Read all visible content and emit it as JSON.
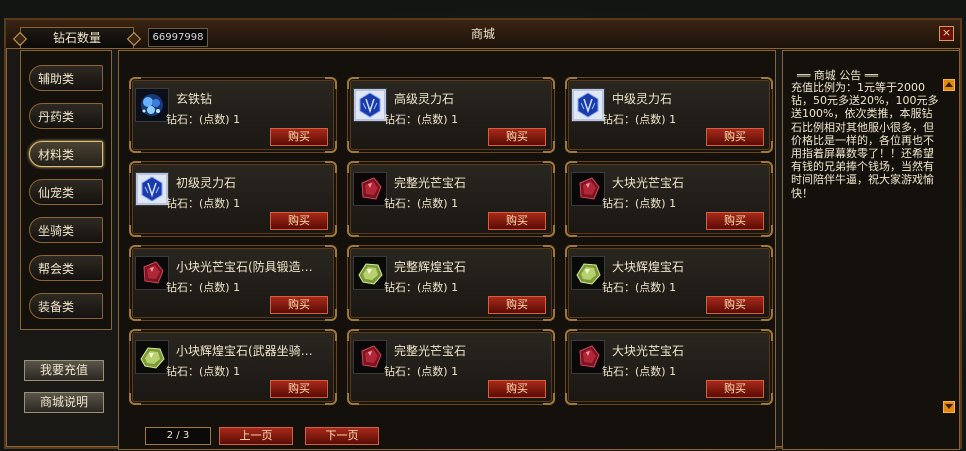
{
  "window": {
    "title": "商城"
  },
  "header": {
    "diamond_label": "钻石数量",
    "diamond_count": "66997998"
  },
  "categories": [
    "辅助类",
    "丹药类",
    "材料类",
    "仙宠类",
    "坐骑类",
    "帮会类",
    "装备类"
  ],
  "active_category": "材料类",
  "side_buttons": {
    "recharge": "我要充值",
    "help": "商城说明"
  },
  "buy_label": "购买",
  "items": [
    {
      "name": "玄铁钻",
      "price": "钻石：(点数) 1",
      "icon": "blue-crystal-icon"
    },
    {
      "name": "高级灵力石",
      "price": "钻石：(点数) 1",
      "icon": "blue-spirit-stone-icon"
    },
    {
      "name": "中级灵力石",
      "price": "钻石：(点数) 1",
      "icon": "blue-spirit-stone-icon"
    },
    {
      "name": "初级灵力石",
      "price": "钻石：(点数) 1",
      "icon": "blue-spirit-stone-icon"
    },
    {
      "name": "完整光芒宝石",
      "price": "钻石：(点数) 1",
      "icon": "red-gem-icon"
    },
    {
      "name": "大块光芒宝石",
      "price": "钻石：(点数) 1",
      "icon": "red-gem-icon"
    },
    {
      "name": "小块光芒宝石(防具锻造…",
      "price": "钻石：(点数) 1",
      "icon": "red-gem-icon"
    },
    {
      "name": "完整辉煌宝石",
      "price": "钻石：(点数) 1",
      "icon": "green-gem-icon"
    },
    {
      "name": "大块辉煌宝石",
      "price": "钻石：(点数) 1",
      "icon": "green-gem-icon"
    },
    {
      "name": "小块辉煌宝石(武器坐骑…",
      "price": "钻石：(点数) 1",
      "icon": "green-gem-icon"
    },
    {
      "name": "完整光芒宝石",
      "price": "钻石：(点数) 1",
      "icon": "red-gem-icon"
    },
    {
      "name": "大块光芒宝石",
      "price": "钻石：(点数) 1",
      "icon": "red-gem-icon"
    }
  ],
  "pager": {
    "page": "2 / 3",
    "prev": "上一页",
    "next": "下一页"
  },
  "notice": {
    "title": "══ 商城 公告 ══",
    "body": "充值比例为：1元等于2000钻，50元多送20%，100元多送100%，依次类推，本服钻石比例相对其他服小很多，但价格比是一样的，各位再也不用指着屏幕数零了！！还希望有钱的兄弟捧个钱场，当然有时间陪伴牛逼，祝大家游戏愉快！"
  },
  "colors": {
    "buy_button": "#a8291a",
    "panel_border": "#8b6430",
    "scroll_arrow": "#e08a10"
  }
}
